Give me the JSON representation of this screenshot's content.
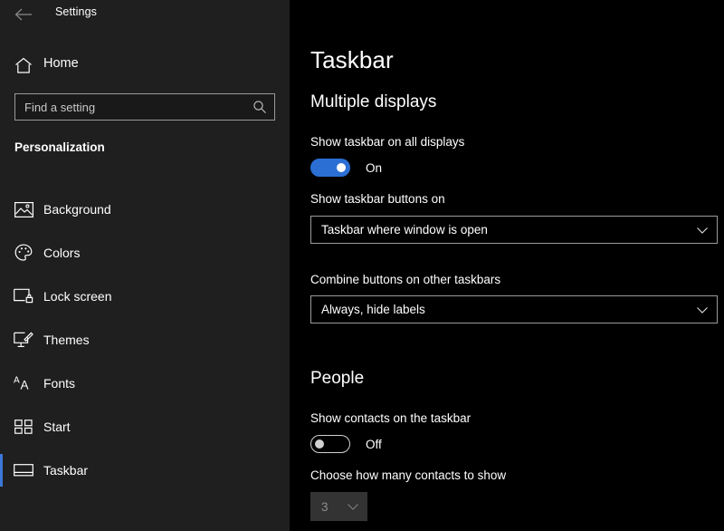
{
  "window": {
    "title": "Settings",
    "back_icon": "back-arrow-icon"
  },
  "sidebar": {
    "home": {
      "label": "Home",
      "icon": "home-icon"
    },
    "search": {
      "placeholder": "Find a setting",
      "value": "",
      "icon": "search-icon"
    },
    "section_label": "Personalization",
    "items": [
      {
        "label": "Background",
        "icon": "image-icon",
        "selected": false
      },
      {
        "label": "Colors",
        "icon": "palette-icon",
        "selected": false
      },
      {
        "label": "Lock screen",
        "icon": "monitor-lock-icon",
        "selected": false
      },
      {
        "label": "Themes",
        "icon": "monitor-brush-icon",
        "selected": false
      },
      {
        "label": "Fonts",
        "icon": "font-size-icon",
        "selected": false
      },
      {
        "label": "Start",
        "icon": "tiles-grid-icon",
        "selected": false
      },
      {
        "label": "Taskbar",
        "icon": "taskbar-icon",
        "selected": true
      }
    ]
  },
  "main": {
    "page_title": "Taskbar",
    "groups": [
      {
        "heading": "Multiple displays",
        "toggle": {
          "label": "Show taskbar on all displays",
          "state_text": "On",
          "checked": true
        },
        "dropdowns": [
          {
            "label": "Show taskbar buttons on",
            "value": "Taskbar where window is open",
            "disabled": false
          },
          {
            "label": "Combine buttons on other taskbars",
            "value": "Always, hide labels",
            "disabled": false
          }
        ]
      },
      {
        "heading": "People",
        "toggle": {
          "label": "Show contacts on the taskbar",
          "state_text": "Off",
          "checked": false
        },
        "dropdowns": [
          {
            "label": "Choose how many contacts to show",
            "value": "3",
            "disabled": true
          }
        ]
      }
    ]
  },
  "colors": {
    "accent": "#3b78d8",
    "toggle_on": "#2b6fd4",
    "sidebar_bg": "#1f1f1f",
    "content_bg": "#000000",
    "border": "#9a9a9a",
    "disabled_fill": "#333333",
    "disabled_text": "#8c8c8c"
  }
}
